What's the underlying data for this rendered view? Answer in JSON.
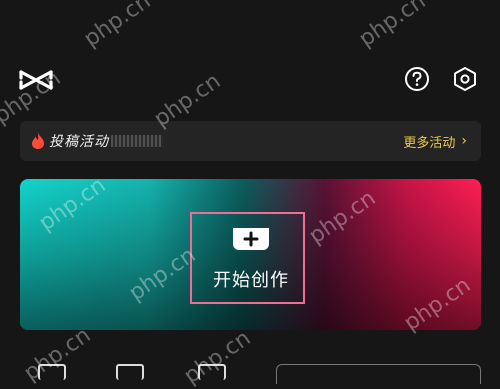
{
  "app": {
    "name": "CapCut",
    "accent": "#f2c94c"
  },
  "header": {
    "help_icon": "question-circle-icon",
    "settings_icon": "hexagon-gear-icon"
  },
  "activity_bar": {
    "title": "投稿活动",
    "more_label": "更多活动",
    "more_chevron": "›"
  },
  "create_card": {
    "plus_symbol": "+",
    "label": "开始创作",
    "gradient_colors": [
      "#13d4cc",
      "#c81448",
      "#ff1f55"
    ]
  },
  "watermark": {
    "text": "php.cn"
  }
}
